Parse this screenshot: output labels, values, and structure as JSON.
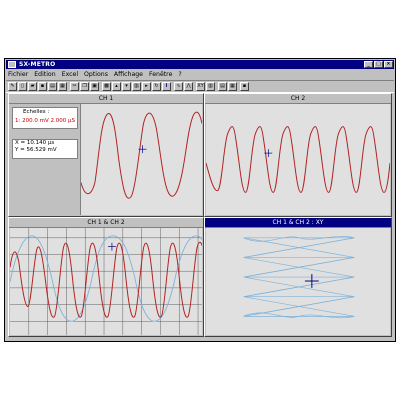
{
  "window": {
    "title": "SX-METRO",
    "min": "_",
    "max": "□",
    "close": "×"
  },
  "menu": [
    "Fichier",
    "Edition",
    "Excel",
    "Options",
    "Affichage",
    "Fenêtre",
    "?"
  ],
  "toolbar": {
    "xy_label": "XY"
  },
  "panels": {
    "ch1": {
      "title": "CH 1"
    },
    "ch2": {
      "title": "CH 2"
    },
    "ch12": {
      "title": "CH 1 & CH 2"
    },
    "xy": {
      "title": "CH 1 & CH 2 : XY"
    }
  },
  "scales": {
    "heading": "Echelles :",
    "ch1": "1: 200.0 mV    2.000 µS"
  },
  "cursor": {
    "x": "X = 10.140 µs",
    "y": "Y = 56.529 mV"
  },
  "colors": {
    "ch1": "#b22222",
    "ch2": "#7fb2d8",
    "titlebar": "#000080"
  }
}
